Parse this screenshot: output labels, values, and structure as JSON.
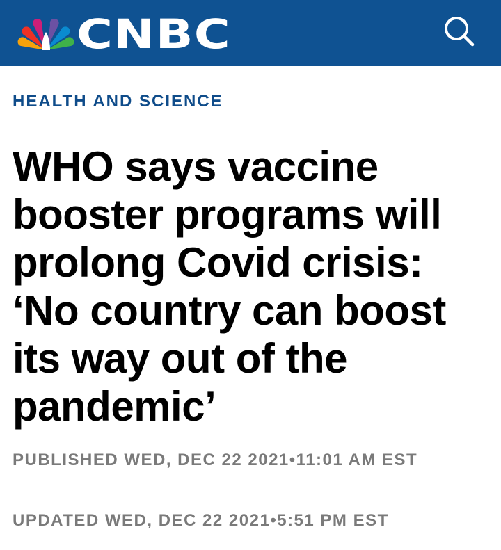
{
  "header": {
    "logo_text": "CNBC",
    "search_icon": "search-icon",
    "background_color": "#0f5292"
  },
  "article": {
    "section": "HEALTH AND SCIENCE",
    "headline": "WHO says vaccine booster programs will prolong Covid crisis: ‘No country can boost its way out of the pandemic’",
    "published": "PUBLISHED WED, DEC 22 2021•11:01 AM EST",
    "updated": "UPDATED WED, DEC 22 2021•5:51 PM EST"
  },
  "colors": {
    "section": "#0f4c8a",
    "meta": "#7a7a7a",
    "headline": "#000000"
  }
}
